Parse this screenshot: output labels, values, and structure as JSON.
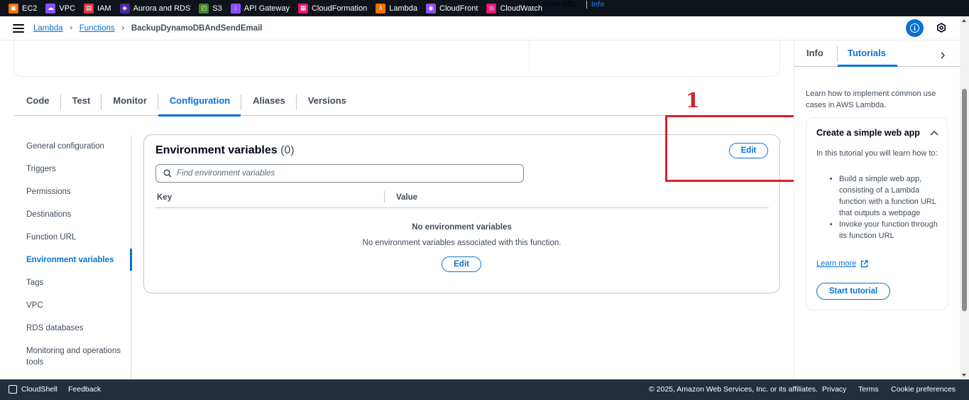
{
  "services": [
    {
      "label": "EC2",
      "color": "#ed7100",
      "icon": "ec2-icon"
    },
    {
      "label": "VPC",
      "color": "#8c4fff",
      "icon": "vpc-icon"
    },
    {
      "label": "IAM",
      "color": "#dd344c",
      "icon": "iam-icon"
    },
    {
      "label": "Aurora and RDS",
      "color": "#4d27aa",
      "icon": "rds-icon"
    },
    {
      "label": "S3",
      "color": "#3f8624",
      "icon": "s3-icon"
    },
    {
      "label": "API Gateway",
      "color": "#8c4fff",
      "icon": "api-gateway-icon"
    },
    {
      "label": "CloudFormation",
      "color": "#e7157b",
      "icon": "cloudformation-icon"
    },
    {
      "label": "Lambda",
      "color": "#ed7100",
      "icon": "lambda-icon"
    },
    {
      "label": "CloudFront",
      "color": "#8c4fff",
      "icon": "cloudfront-icon"
    },
    {
      "label": "CloudWatch",
      "color": "#e7157b",
      "icon": "cloudwatch-icon"
    }
  ],
  "breadcrumb": {
    "lambda": "Lambda",
    "functions": "Functions",
    "current": "BackupDynamoDBAndSendEmail"
  },
  "function_url": {
    "label": "Function URL",
    "info": "Info",
    "value": "-"
  },
  "tabs": [
    "Code",
    "Test",
    "Monitor",
    "Configuration",
    "Aliases",
    "Versions"
  ],
  "active_tab": "Configuration",
  "side_nav": [
    "General configuration",
    "Triggers",
    "Permissions",
    "Destinations",
    "Function URL",
    "Environment variables",
    "Tags",
    "VPC",
    "RDS databases",
    "Monitoring and operations tools"
  ],
  "env": {
    "title": "Environment variables",
    "count": "(0)",
    "edit": "Edit",
    "search_placeholder": "Find environment variables",
    "col_key": "Key",
    "col_value": "Value",
    "empty_title": "No environment variables",
    "empty_desc": "No environment variables associated with this function.",
    "empty_edit": "Edit"
  },
  "annotation": "1",
  "help_panel": {
    "tab_info": "Info",
    "tab_tutorials": "Tutorials",
    "intro": "Learn how to implement common use cases in AWS Lambda.",
    "card_title": "Create a simple web app",
    "card_desc": "In this tutorial you will learn how to:",
    "bullets": [
      "Build a simple web app, consisting of a Lambda function with a function URL that outputs a webpage",
      "Invoke your function through its function URL"
    ],
    "learn_more": "Learn more",
    "start": "Start tutorial"
  },
  "footer": {
    "cloudshell": "CloudShell",
    "feedback": "Feedback",
    "copyright": "© 2025, Amazon Web Services, Inc. or its affiliates.",
    "privacy": "Privacy",
    "terms": "Terms",
    "cookies": "Cookie preferences"
  }
}
